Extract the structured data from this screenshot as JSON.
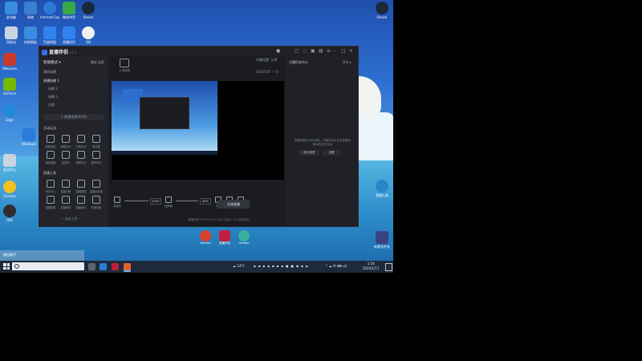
{
  "desktop": {
    "icons_left": [
      {
        "label": "此电脑",
        "color": "#3a8de0"
      },
      {
        "label": "网络",
        "color": "#3a7fd0"
      },
      {
        "label": "Internet Explorer",
        "color": "#2a7ad8"
      },
      {
        "label": "微软拼音",
        "color": "#38a848"
      },
      {
        "label": "Steam",
        "color": "#1b2838"
      },
      {
        "label": "回收站",
        "color": "#c8d4e0"
      },
      {
        "label": "控制面板",
        "color": "#3a8de0"
      },
      {
        "label": "百度网盘",
        "color": "#2f82f0"
      },
      {
        "label": "直播伴侣",
        "color": "#2f82f0"
      },
      {
        "label": "QQ",
        "color": "#f0f0f0"
      },
      {
        "label": "WeGame",
        "color": "#c83a2a"
      },
      {
        "label": "GeForce",
        "color": "#76b900"
      },
      {
        "label": "Edge",
        "color": "#1f8ad8"
      },
      {
        "label": "Windows",
        "color": "#2a7ad8"
      },
      {
        "label": "安全中心",
        "color": "#c8d4e0"
      },
      {
        "label": "Chrome",
        "color": "#f0c020"
      },
      {
        "label": "OBS",
        "color": "#302e31"
      }
    ],
    "icons_right": [
      {
        "label": "Steam",
        "color": "#1b2838"
      },
      {
        "label": "直播工具",
        "color": "#2a86c8"
      },
      {
        "label": "新建文件夹",
        "color": "#3a4080"
      }
    ],
    "dock": [
      {
        "label": "Tencent",
        "color": "#d84030"
      },
      {
        "label": "直播伴侣",
        "color": "#c02040"
      },
      {
        "label": "Ameba",
        "color": "#38b0a0"
      }
    ],
    "mini_panel_label": "微信助手"
  },
  "app": {
    "title": "直播伴侣",
    "version": "v5.1",
    "sidebar": {
      "mode_label": "智能模式 ▾",
      "tab_a": "横屏",
      "tab_b": "竖屏",
      "section_scenes": "我的场景",
      "scenes": [
        "直播场景 1",
        "场景 2",
        "场景 3",
        "全屏"
      ],
      "add_scene": "+ 新建场景(0/10)",
      "section_interact": "互动玩法",
      "interact_tools": [
        "投屏连麦",
        "弹幕互动",
        "礼物互动",
        "粉丝团",
        "抽奖福袋",
        "连麦PK",
        "投票玩法",
        "更多玩法"
      ],
      "section_live": "直播工具",
      "live_tools": [
        "任务中心",
        "直播诊断",
        "直播数据",
        "直播间设置",
        "直播录屏",
        "直播美颜",
        "直播助手",
        "开播设置"
      ],
      "more_tools": "— 全部工具 —"
    },
    "toolbar_icon_label": "上传视频",
    "stats": {
      "a": "开播设置",
      "b": "分享",
      "c": "14:07:07",
      "d": "0"
    },
    "right_panel": {
      "title": "主播任务中心",
      "right": "评论 ▸",
      "message": "直播间暂无评论消息，开播后可以在这里看到观众的实时互动",
      "btn_a": "观众管理",
      "btn_b": "设置"
    },
    "bottom": {
      "mic_label": "麦克风",
      "mic_pct": "100%",
      "spk_label": "扬声器",
      "spk_pct": "86%",
      "btn_effect": "特效",
      "btn_more": "更多",
      "btn_set": "设置",
      "live_btn": "开始直播"
    },
    "footer": "直播码率  FPS:60  CPU:20%  内存:5.2G  网络良好"
  },
  "taskbar": {
    "weather": "14°C",
    "tray_text": "^ ☁ 中 ⌨ ◂))",
    "time": "1:54",
    "date": "2024/1/17"
  }
}
